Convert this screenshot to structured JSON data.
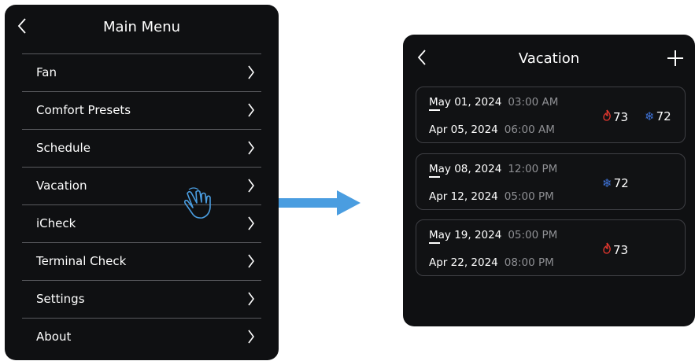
{
  "main_menu": {
    "title": "Main Menu",
    "items": [
      {
        "label": "Fan"
      },
      {
        "label": "Comfort Presets"
      },
      {
        "label": "Schedule"
      },
      {
        "label": "Vacation"
      },
      {
        "label": "iCheck"
      },
      {
        "label": "Terminal Check"
      },
      {
        "label": "Settings"
      },
      {
        "label": "About"
      }
    ]
  },
  "vacation": {
    "title": "Vacation",
    "entries": [
      {
        "start_date": "May 01, 2024",
        "start_time": "03:00 AM",
        "end_date": "Apr 05, 2024",
        "end_time": "06:00 AM",
        "heat": "73",
        "cool": "72"
      },
      {
        "start_date": "May 08, 2024",
        "start_time": "12:00 PM",
        "end_date": "Apr 12, 2024",
        "end_time": "05:00 PM",
        "cool": "72"
      },
      {
        "start_date": "May 19, 2024",
        "start_time": "05:00 PM",
        "end_date": "Apr 22, 2024",
        "end_time": "08:00 PM",
        "heat": "73"
      }
    ]
  },
  "colors": {
    "panel": "#0f1012",
    "heat": "#e8382f",
    "cool": "#3f73d8",
    "arrow": "#4a9de0"
  },
  "icons": [
    "back-icon",
    "chevron-right-icon",
    "plus-icon",
    "flame-icon",
    "snowflake-icon",
    "hand-pointer-icon",
    "right-arrow-icon"
  ]
}
